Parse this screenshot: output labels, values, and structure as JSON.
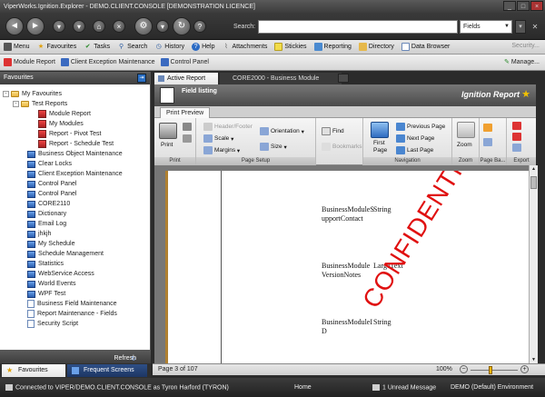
{
  "window": {
    "title": "ViperWorks.Ignition.Explorer - DEMO.CLIENT.CONSOLE [DEMONSTRATION LICENCE]"
  },
  "addressbar": {
    "search_label": "Search:",
    "search_value": "",
    "fields_selected": "Fields"
  },
  "menu": {
    "items": [
      "Menu",
      "Favourites",
      "Tasks",
      "Search",
      "History",
      "Help",
      "Attachments",
      "Stickies",
      "Reporting",
      "Directory",
      "Data Browser"
    ],
    "security": "Security..."
  },
  "quickbar": {
    "items": [
      "Module Report",
      "Client Exception Maintenance",
      "Control Panel"
    ],
    "manage": "Manage..."
  },
  "favourites_panel": {
    "header": "Favourites",
    "root": "My Favourites",
    "test_reports": "Test Reports",
    "reports": [
      "Module Report",
      "My Modules",
      "Report - Pivot Test",
      "Report - Schedule Test"
    ],
    "apps": [
      "Business Object Maintenance",
      "Clear Locks",
      "Client Exception Maintenance",
      "Control Panel",
      "Control Panel",
      "CORE2110",
      "Dictionary",
      "Email Log",
      "jhkjh",
      "My Schedule",
      "Schedule Management",
      "Statistics",
      "WebService Access",
      "World Events",
      "WPF Test"
    ],
    "docs": [
      "Business Field Maintenance",
      "Report Maintenance - Fields",
      "Security Script"
    ],
    "refresh": "Refresh",
    "tabs": [
      "Favourites",
      "Frequent Screens"
    ]
  },
  "doc_tabs": [
    "Active Report",
    "CORE2000 - Business Module Maintenance"
  ],
  "report_header": {
    "field_listing": "Field listing",
    "title": "Ignition Report"
  },
  "ribbon": {
    "tab": "Print Preview",
    "print_group": {
      "label": "Print",
      "print": "Print"
    },
    "page_setup": {
      "label": "Page Setup",
      "header_footer": "Header/Footer",
      "scale": "Scale",
      "margins": "Margins",
      "orientation": "Orientation",
      "size": "Size"
    },
    "find": "Find",
    "bookmarks": "Bookmarks",
    "navigation": {
      "label": "Navigation",
      "first_page_1": "First",
      "first_page_2": "Page",
      "previous_page": "Previous Page",
      "next_page": "Next Page",
      "last_page": "Last Page"
    },
    "zoom": {
      "label": "Zoom",
      "button": "Zoom"
    },
    "page_background": {
      "label": "Page Ba..."
    },
    "export": {
      "label": "Export"
    }
  },
  "report_page": {
    "rows": [
      {
        "field_1": "BusinessModuleS",
        "field_2": "upportContact",
        "type": "String"
      },
      {
        "field_1": "BusinessModule",
        "field_2": "VersionNotes",
        "type": "LargeText"
      },
      {
        "field_1": "BusinessModuleI",
        "field_2": "D",
        "type": "String"
      }
    ],
    "watermark": "CONFIDENTIAL"
  },
  "status_strip": {
    "page_of": "Page 3 of 107",
    "zoom": "100%",
    "zoom_level": 0.42
  },
  "footer": {
    "connection": "Connected to VIPER/DEMO.CLIENT.CONSOLE as Tyron Harford (TYRON)",
    "home": "Home",
    "messages": "1 Unread Message",
    "environment": "DEMO (Default) Environment"
  }
}
